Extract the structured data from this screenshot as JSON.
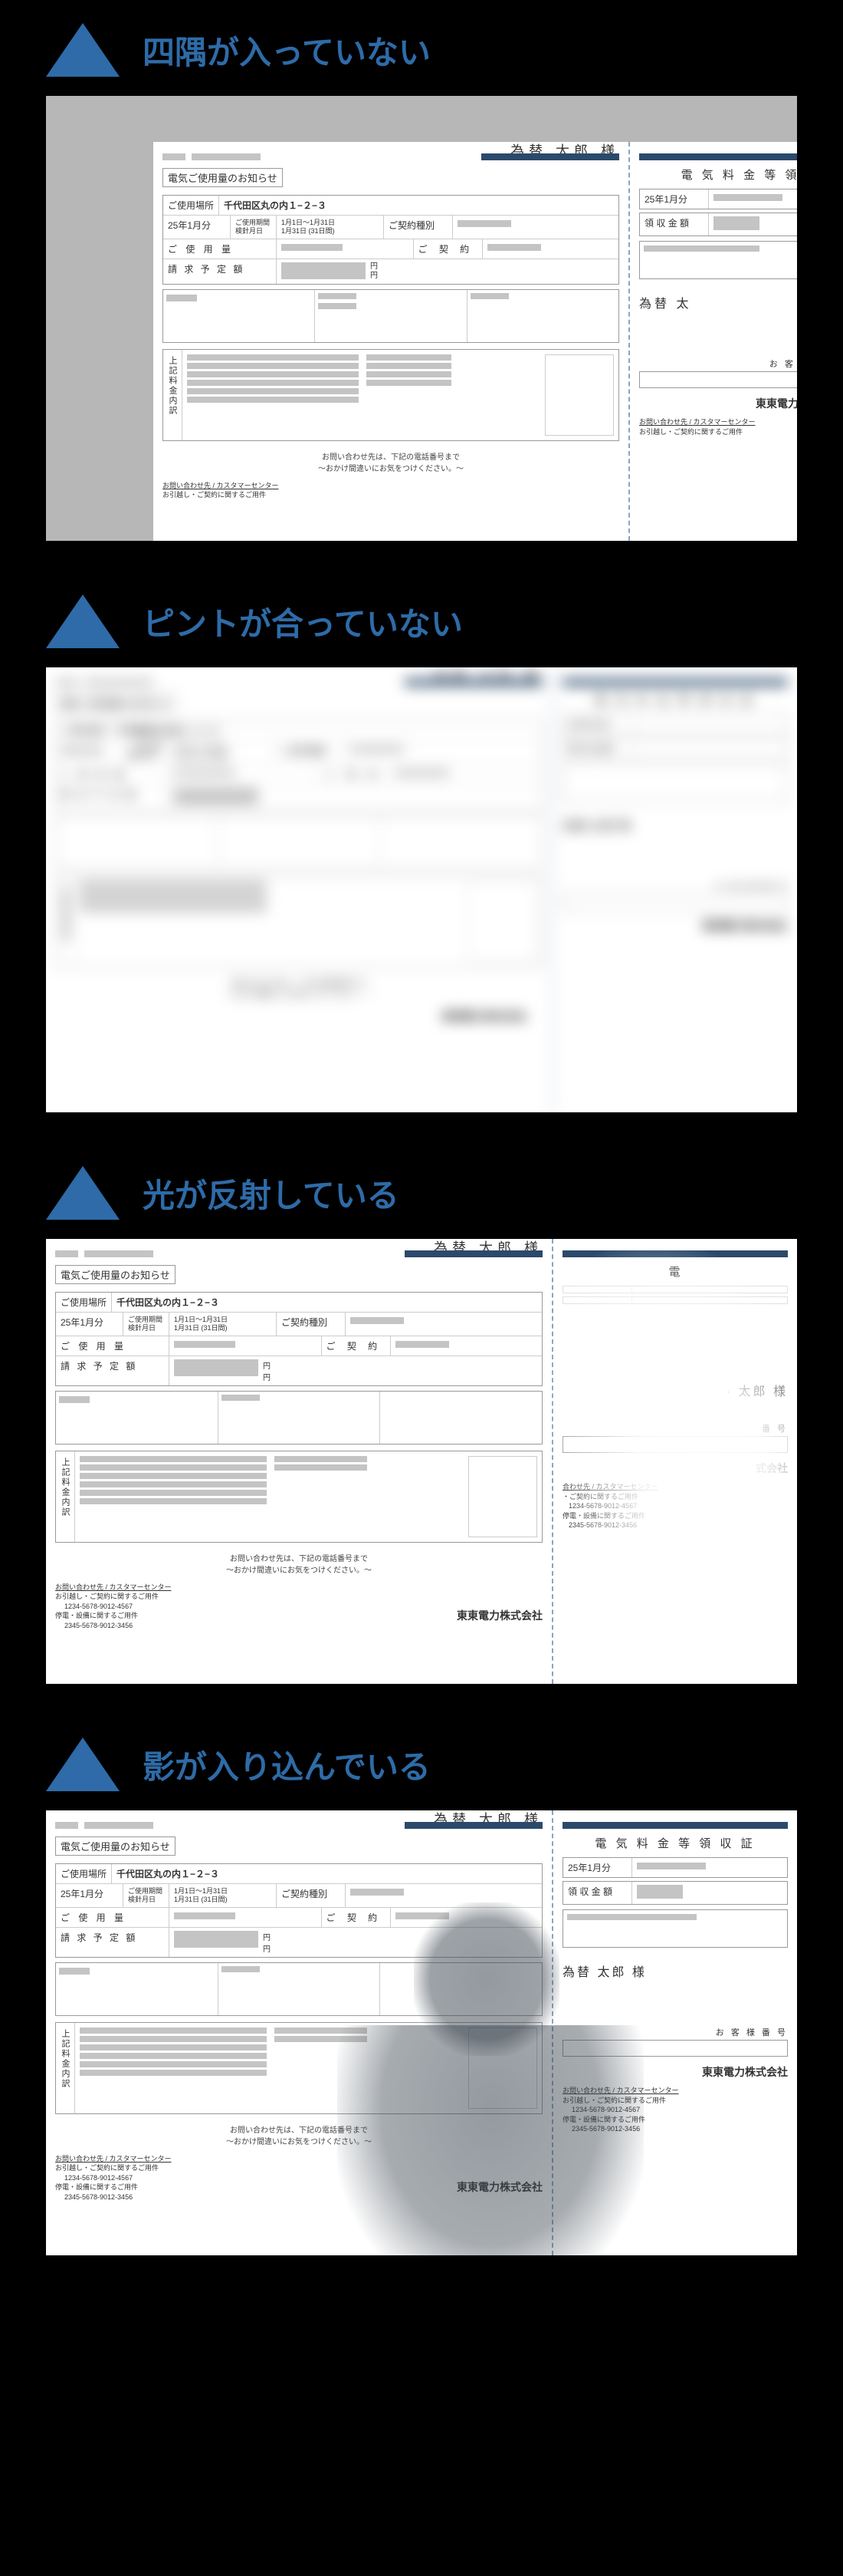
{
  "sections": {
    "s1": {
      "title": "四隅が入っていない"
    },
    "s2": {
      "title": "ピントが合っていない"
    },
    "s3": {
      "title": "光が反射している"
    },
    "s4": {
      "title": "影が入り込んでいる"
    }
  },
  "bill": {
    "notice_title": "電気ご使用量のお知らせ",
    "name": "為替 太郎 様",
    "location_label": "ご使用場所",
    "location": "千代田区丸の内１−２−３",
    "month": "25年1月分",
    "period_label": "ご使用期間\n検針月日",
    "period": "1月1日〜1月31日\n1月31日 (31日間)",
    "contract_type_label": "ご契約種別",
    "usage_label": "ご 使 用 量",
    "contract_label": "ご 契 約",
    "billing_label": "請 求 予 定 額",
    "yen": "円",
    "breakdown_label": "上記料金内訳",
    "footer1": "お問い合わせ先は、下記の電話番号まで",
    "footer2": "〜おかけ間違いにお気をつけください。〜",
    "contact_header": "お問い合わせ先 / カスタマーセンター",
    "contact_line1": "お引越し・ご契約に関するご用件",
    "contact_tel1": "1234-5678-9012-4567",
    "contact_line2": "停電・設備に関するご用件",
    "contact_tel2": "2345-5678-9012-3456",
    "company": "東東電力株式会社",
    "receipt_title": "電 気 料 金 等 領 収 証",
    "receipt_month_label": "25年1月分",
    "receipt_amount_label": "領 収 金 額",
    "customer_no_label": "お 客 様 番 号"
  }
}
